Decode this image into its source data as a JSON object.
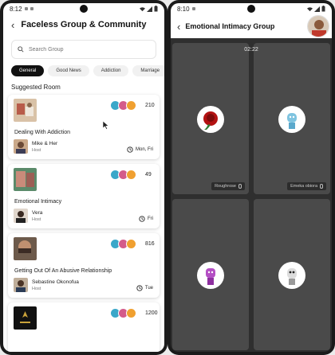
{
  "left": {
    "status_time": "8:12",
    "title": "Faceless Group & Community",
    "search_placeholder": "Search Group",
    "chips": [
      {
        "label": "General",
        "active": true
      },
      {
        "label": "Good News",
        "active": false
      },
      {
        "label": "Addiction",
        "active": false
      },
      {
        "label": "Marriage",
        "active": false
      }
    ],
    "section_title": "Suggested Room",
    "rooms": [
      {
        "name": "Dealing With Addiction",
        "count": "210",
        "host_name": "Mike & Her",
        "host_label": "Host",
        "schedule": "Mon, Fri"
      },
      {
        "name": "Emotional Intimacy",
        "count": "49",
        "host_name": "Vera",
        "host_label": "Host",
        "schedule": "Fri"
      },
      {
        "name": "Getting Out Of An Abusive Relationship",
        "count": "816",
        "host_name": "Sebastine Okonofua",
        "host_label": "Host",
        "schedule": "Tue"
      },
      {
        "name": "",
        "count": "1200",
        "host_name": "",
        "host_label": "",
        "schedule": ""
      }
    ]
  },
  "right": {
    "status_time": "8:10",
    "title": "Emotional Intimacy Group",
    "timer": "02:22",
    "participants": [
      {
        "name": "Roughrose"
      },
      {
        "name": "Emeka obiora"
      },
      {
        "name": ""
      },
      {
        "name": ""
      }
    ]
  },
  "colors": {
    "chip_active_bg": "#111111",
    "call_background": "#2f2f2f",
    "tile_background": "#4a4a4a",
    "avatar_1": "#3aa7c9",
    "avatar_2": "#d45b8a",
    "avatar_3": "#f0a030"
  }
}
